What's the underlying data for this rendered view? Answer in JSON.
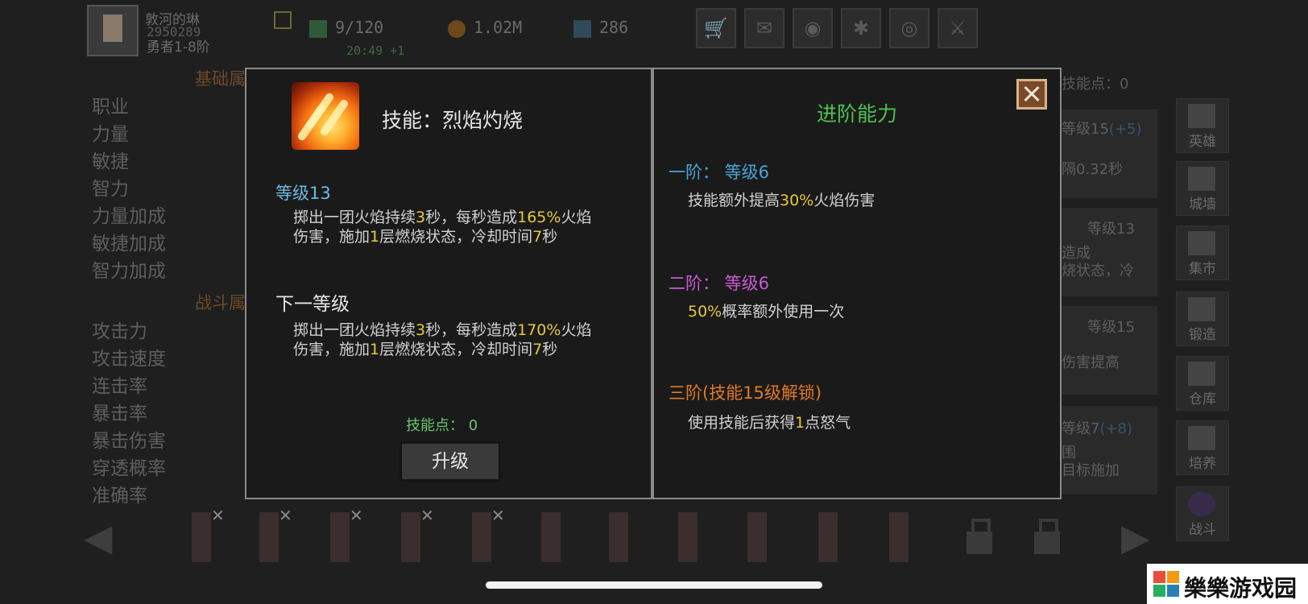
{
  "player": {
    "name": "敦河的琳",
    "id": "2950289",
    "rank": "勇者1-8阶"
  },
  "resources": {
    "energy": "9/120",
    "timer": "20:49 +1",
    "gold": "1.02M",
    "gems": "286"
  },
  "top_buttons": [
    "shop-icon",
    "mail-icon",
    "gamepad-icon",
    "gear-icon",
    "color-wheel-icon",
    "sword-icon"
  ],
  "background_left": {
    "section1": "基础属",
    "section2": "战斗属",
    "stats1": [
      "职业",
      "力量",
      "敏捷",
      "智力",
      "力量加成",
      "敏捷加成",
      "智力加成"
    ],
    "stats2": [
      "攻击力",
      "攻击速度",
      "连击率",
      "暴击率",
      "暴击伤害",
      "穿透概率",
      "准确率"
    ]
  },
  "background_right": {
    "points": "技能点：0",
    "card1_a": "等级15",
    "card1_a_plus": "(+5)",
    "card1_b": "隔0.32秒",
    "card2_a": "等级13",
    "card2_b": "造成",
    "card2_c": "烧状态，冷",
    "card3_a": "等级15",
    "card3_b": "伤害提高",
    "card4_a": "等级7",
    "card4_a_plus": "(+8)",
    "card4_b": "围",
    "card4_c": "目标施加"
  },
  "side_nav": [
    "英雄",
    "城墙",
    "集市",
    "锻造",
    "仓库",
    "培养",
    "战斗"
  ],
  "dialog": {
    "skill_title": "技能：烈焰灼烧",
    "level_label": "等级13",
    "current_desc": {
      "p1": "掷出一团火焰持续",
      "n1": "3",
      "p2": "秒，每秒造成",
      "n2": "165%",
      "p3": "火焰",
      "p4": "伤害，施加",
      "n3": "1",
      "p5": "层燃烧状态，冷却时间",
      "n4": "7",
      "p6": "秒"
    },
    "next_label": "下一等级",
    "next_desc": {
      "p1": "掷出一团火焰持续",
      "n1": "3",
      "p2": "秒，每秒造成",
      "n2": "170%",
      "p3": "火焰",
      "p4": "伤害，施加",
      "n3": "1",
      "p5": "层燃烧状态，冷却时间",
      "n4": "7",
      "p6": "秒"
    },
    "skill_points": "技能点：  0",
    "upgrade_button": "升级",
    "advanced_title": "进阶能力",
    "tier1": {
      "label": "一阶：  等级6",
      "desc_a": "技能额外提高",
      "desc_n": "30%",
      "desc_b": "火焰伤害",
      "color": "#4aa3d8"
    },
    "tier2": {
      "label": "二阶：  等级6",
      "desc_n": "50%",
      "desc_b": "概率额外使用一次",
      "color": "#c95ad6"
    },
    "tier3": {
      "label": "三阶(技能15级解锁)",
      "desc_a": "使用技能后获得",
      "desc_n": "1",
      "desc_b": "点怒气",
      "color": "#e07a26"
    }
  },
  "watermark": "樂樂游戏园",
  "colors": {
    "accent_green": "#4fc24f",
    "highlight_yellow": "#e6c93a",
    "level_blue": "#6fb8e0"
  }
}
